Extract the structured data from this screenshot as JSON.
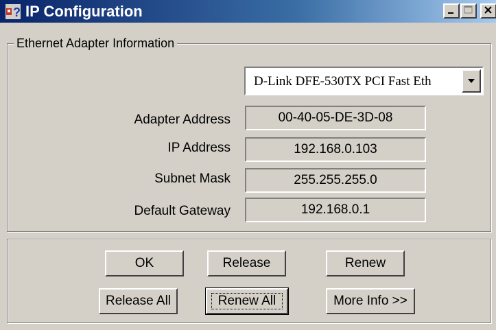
{
  "window": {
    "title": "IP Configuration",
    "minimize_icon": "minimize-icon",
    "maximize_icon": "maximize-icon",
    "close_icon": "close-icon",
    "title_gradient": [
      "#0a246a",
      "#a6caf0"
    ]
  },
  "group": {
    "legend": "Ethernet  Adapter Information"
  },
  "adapter_select": {
    "selected": "D-Link DFE-530TX PCI Fast Eth"
  },
  "fields": [
    {
      "label": "Adapter Address",
      "value": "00-40-05-DE-3D-08"
    },
    {
      "label": "IP Address",
      "value": "192.168.0.103"
    },
    {
      "label": "Subnet Mask",
      "value": "255.255.255.0"
    },
    {
      "label": "Default Gateway",
      "value": "192.168.0.1"
    }
  ],
  "buttons": {
    "ok": "OK",
    "release": "Release",
    "renew": "Renew",
    "release_all": "Release All",
    "renew_all": "Renew All",
    "more_info": "More Info >>"
  }
}
